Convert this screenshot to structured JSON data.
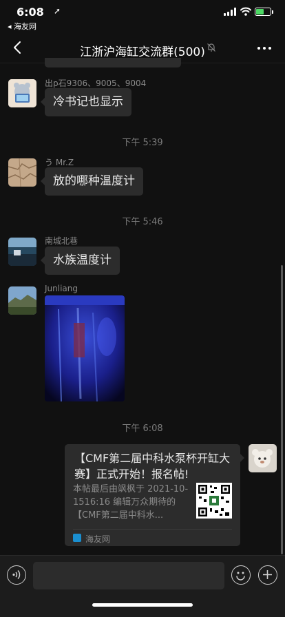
{
  "status_bar": {
    "time": "6:08",
    "location_arrow": "➚",
    "back_to_app": "◂ 海友网",
    "battery_level": 0.6,
    "battery_color": "#4cd964",
    "signal_icon": "signal-icon",
    "wifi_icon": "wifi-icon"
  },
  "nav": {
    "title": "江浙沪海缸交流群(500)",
    "back_icon": "chevron-left-icon",
    "mute_icon": "bell-off-icon",
    "more_icon": "more-dots-icon"
  },
  "messages": [
    {
      "sender": "出p石9306、9005、9004",
      "text": "冷书记也显示"
    },
    {
      "timestamp": "下午 5:39"
    },
    {
      "sender": "う Mr.Z",
      "text": "放的哪种温度计"
    },
    {
      "timestamp": "下午 5:46"
    },
    {
      "sender": "南城北巷",
      "text": "水族温度计"
    },
    {
      "sender": "Junliang",
      "type": "image"
    },
    {
      "timestamp": "下午 6:08"
    },
    {
      "type": "link_card",
      "title": "【CMF第二届中科水泵杯开缸大赛】正式开始！报名帖!",
      "description": "本帖最后由飒枫于 2021-10-1516:16 编辑万众期待的【CMF第二届中科水...",
      "source": "海友网"
    }
  ],
  "input_bar": {
    "voice_icon": "voice-icon",
    "emoji_icon": "emoji-icon",
    "plus_icon": "plus-icon"
  },
  "colors": {
    "background": "#111111",
    "bubble": "#2c2c2c",
    "secondary_text": "#8a8a8a"
  }
}
